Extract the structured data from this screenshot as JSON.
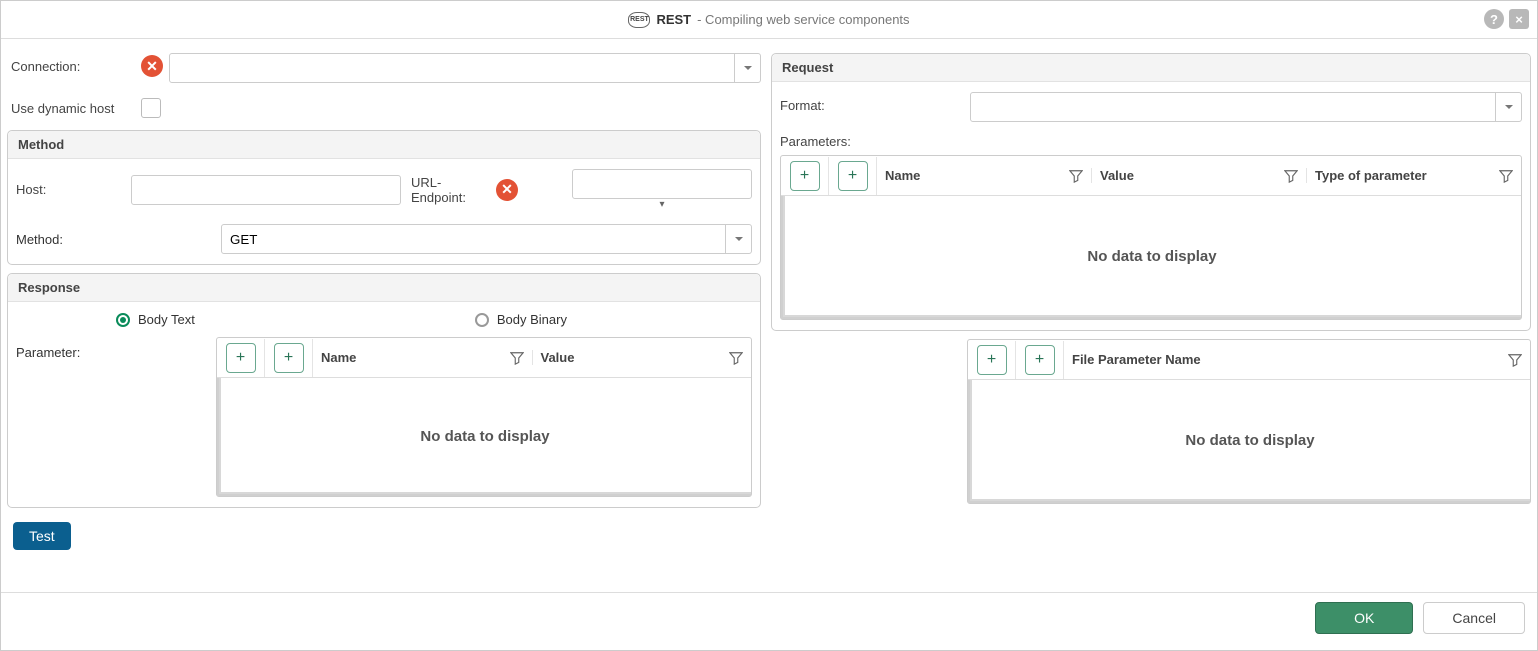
{
  "title": {
    "badge": "REST",
    "main": "REST",
    "sub": " - Compiling web service components"
  },
  "labels": {
    "connection": "Connection:",
    "use_dynamic_host": "Use dynamic host",
    "method_panel": "Method",
    "host": "Host:",
    "url_endpoint": "URL-Endpoint:",
    "method": "Method:",
    "response_panel": "Response",
    "body_text": "Body Text",
    "body_binary": "Body Binary",
    "parameter": "Parameter:",
    "request_panel": "Request",
    "format": "Format:",
    "parameters": "Parameters:",
    "file_param_name": "File Parameter Name",
    "col_name": "Name",
    "col_value": "Value",
    "col_type": "Type of parameter",
    "no_data": "No data to display"
  },
  "values": {
    "connection": "",
    "use_dynamic_host_checked": false,
    "host": "",
    "url_endpoint": "",
    "method_selected": "GET",
    "response_mode": "body_text",
    "format": ""
  },
  "buttons": {
    "test": "Test",
    "ok": "OK",
    "cancel": "Cancel",
    "plus": "+"
  }
}
